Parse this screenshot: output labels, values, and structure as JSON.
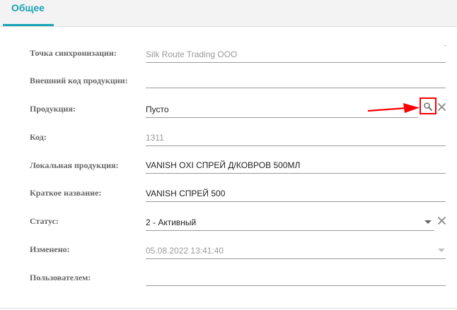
{
  "tabs": [
    {
      "label": "Общее"
    }
  ],
  "form": {
    "sync_point": {
      "label": "Точка синхронизации:",
      "value": "Silk Route Trading OOO"
    },
    "external_code": {
      "label": "Внешний код продукции:",
      "value": ""
    },
    "product": {
      "label": "Продукция:",
      "value": "Пусто"
    },
    "code": {
      "label": "Код:",
      "value": "1311"
    },
    "local_product": {
      "label": "Локальная продукция:",
      "value": "VANISH OXI СПРЕЙ Д/КОВРОВ 500МЛ"
    },
    "short_name": {
      "label": "Краткое название:",
      "value": "VANISH СПРЕЙ 500"
    },
    "status": {
      "label": "Статус:",
      "value": "2 - Активный"
    },
    "modified": {
      "label": "Изменено:",
      "value": "05.08.2022 13:41:40"
    },
    "modified_by": {
      "label": "Пользователем:",
      "value": ""
    }
  },
  "icons": {
    "search": "search-icon",
    "clear": "close-icon",
    "dropdown": "chevron-down-icon",
    "annotation": "arrow-right-icon"
  },
  "colors": {
    "accent": "#1aa3b5",
    "annotation": "#ff0000"
  }
}
